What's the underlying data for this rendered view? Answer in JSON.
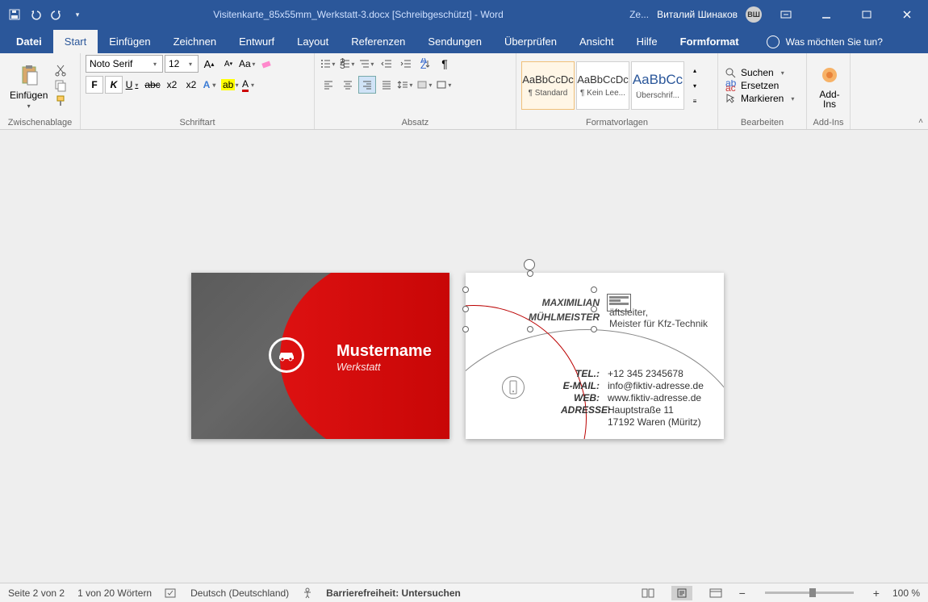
{
  "title": "Visitenkarte_85x55mm_Werkstatt-3.docx [Schreibgeschützt] - Word",
  "user": {
    "name": "Виталий Шинаков",
    "initials": "ВШ",
    "share": "Ze..."
  },
  "tabs": {
    "datei": "Datei",
    "start": "Start",
    "einfuegen": "Einfügen",
    "zeichnen": "Zeichnen",
    "entwurf": "Entwurf",
    "layout": "Layout",
    "referenzen": "Referenzen",
    "sendungen": "Sendungen",
    "ueberpruefen": "Überprüfen",
    "ansicht": "Ansicht",
    "hilfe": "Hilfe",
    "formformat": "Formformat",
    "tell": "Was möchten Sie tun?"
  },
  "ribbon": {
    "clipboard": {
      "paste": "Einfügen",
      "label": "Zwischenablage"
    },
    "font": {
      "name": "Noto Serif",
      "size": "12",
      "label": "Schriftart"
    },
    "para": {
      "label": "Absatz"
    },
    "styles": {
      "items": [
        {
          "prev": "AaBbCcDc",
          "name": "¶ Standard"
        },
        {
          "prev": "AaBbCcDc",
          "name": "¶ Kein Lee..."
        },
        {
          "prev": "AaBbCc",
          "name": "Überschrif...",
          "big": true
        }
      ],
      "label": "Formatvorlagen"
    },
    "edit": {
      "find": "Suchen",
      "replace": "Ersetzen",
      "select": "Markieren",
      "label": "Bearbeiten"
    },
    "addins": {
      "big": "Add-Ins",
      "label": "Add-Ins"
    }
  },
  "card1": {
    "title": "Mustername",
    "sub": "Werkstatt"
  },
  "card2": {
    "name1": "MAXIMILIAN",
    "name2": "MÜHLMEISTER",
    "role1": "äftsleiter,",
    "role2": "Meister für Kfz-Technik",
    "rows": [
      {
        "k": "TEL.:",
        "v": "+12 345 2345678"
      },
      {
        "k": "E-MAIL:",
        "v": "info@fiktiv-adresse.de"
      },
      {
        "k": "WEB:",
        "v": "www.fiktiv-adresse.de"
      },
      {
        "k": "ADRESSE:",
        "v": "Hauptstraße 11"
      },
      {
        "k": "",
        "v": "17192 Waren (Müritz)"
      }
    ]
  },
  "status": {
    "page": "Seite 2 von 2",
    "words": "1 von 20 Wörtern",
    "lang": "Deutsch (Deutschland)",
    "acc": "Barrierefreiheit: Untersuchen",
    "zoom": "100 %"
  }
}
